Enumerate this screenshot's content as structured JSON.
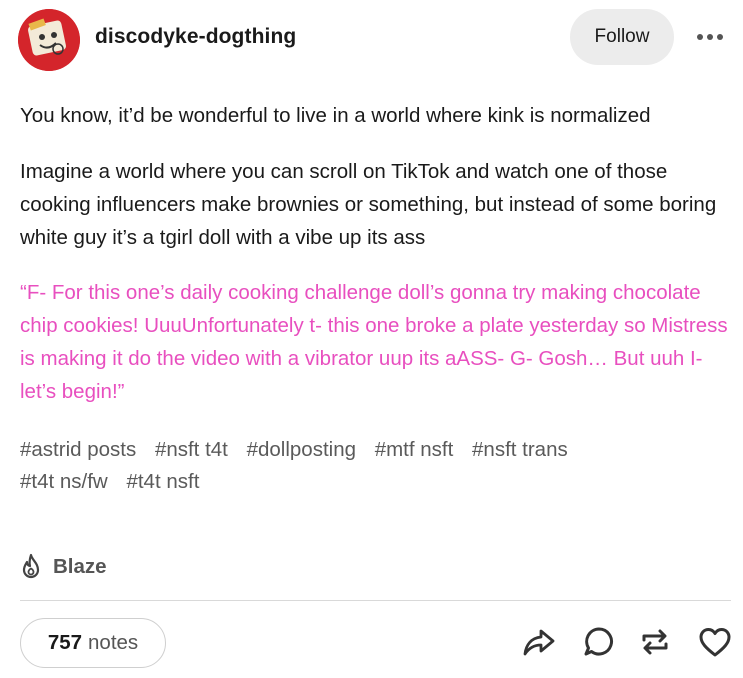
{
  "post": {
    "blog_name": "discodyke-dogthing",
    "follow_label": "Follow",
    "paragraphs": [
      "You know, it’d be wonderful to live in a world where kink is normalized",
      "Imagine a world where you can scroll on TikTok and watch one of those cooking influencers make brownies or something, but instead of some boring white guy it’s a tgirl doll with a vibe up its ass"
    ],
    "quote": "“F- For this one’s daily cooking challenge doll’s gonna try making chocolate chip cookies! UuuUnfortunately t- this one broke a plate yesterday so Mistress is making it do the video with a vibrator uup its aASS- G- Gosh… But uuh I-let’s begin!”",
    "tags": [
      "#astrid posts",
      "#nsft t4t",
      "#dollposting",
      "#mtf nsft",
      "#nsft trans",
      "#t4t ns/fw",
      "#t4t nsft"
    ]
  },
  "footer": {
    "blaze_label": "Blaze",
    "notes_count": "757",
    "notes_label": "notes"
  },
  "icons": {
    "avatar": "avatar-icon",
    "more": "more-options-icon",
    "blaze": "flame-icon",
    "share": "share-icon",
    "reply": "reply-icon",
    "reblog": "reblog-icon",
    "like": "heart-icon"
  },
  "colors": {
    "quote_text": "#e84fbf",
    "tag_text": "#5a5a5a",
    "follow_bg": "#ececec",
    "avatar_bg": "#d4252b"
  }
}
